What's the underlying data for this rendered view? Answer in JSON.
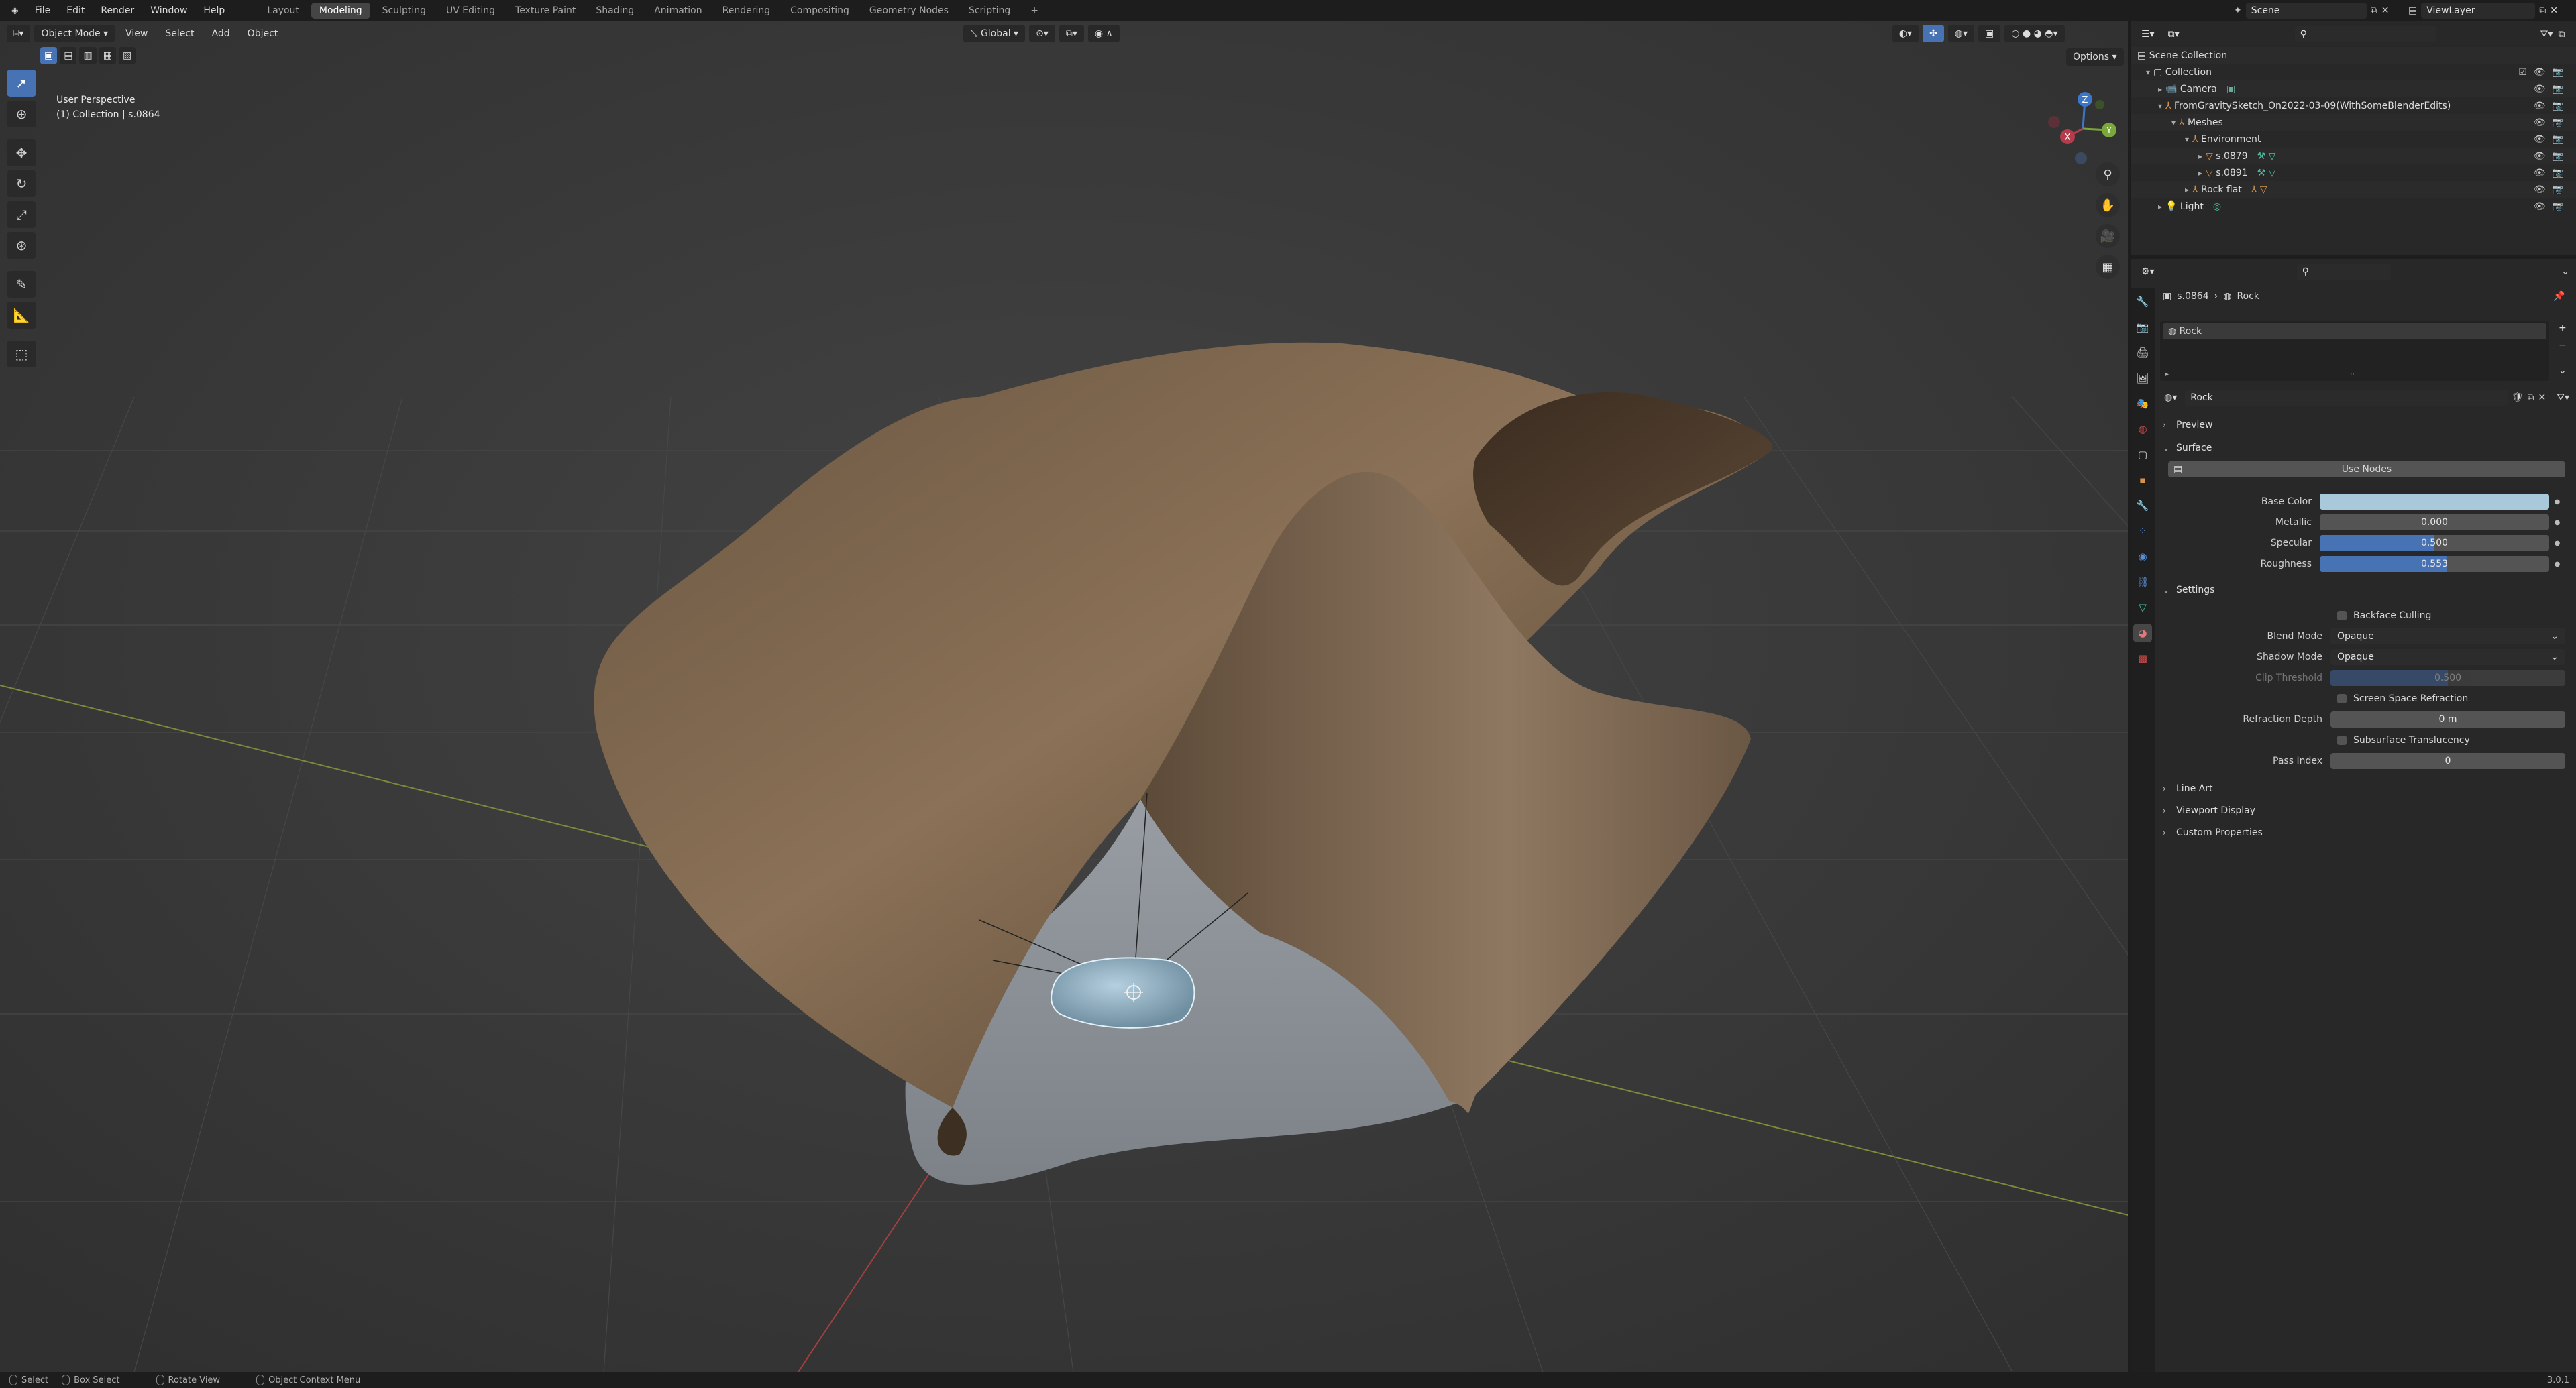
{
  "menu": {
    "file": "File",
    "edit": "Edit",
    "render": "Render",
    "window": "Window",
    "help": "Help"
  },
  "workspaces": [
    "Layout",
    "Modeling",
    "Sculpting",
    "UV Editing",
    "Texture Paint",
    "Shading",
    "Animation",
    "Rendering",
    "Compositing",
    "Geometry Nodes",
    "Scripting"
  ],
  "active_workspace": "Modeling",
  "scene": "Scene",
  "view_layer": "ViewLayer",
  "viewport": {
    "mode": "Object Mode",
    "menus": {
      "view": "View",
      "select": "Select",
      "add": "Add",
      "object": "Object"
    },
    "orientation": "Global",
    "options": "Options",
    "perspective": "User Perspective",
    "collection_info": "(1) Collection | s.0864",
    "gizmo": {
      "x": "X",
      "y": "Y",
      "z": "Z"
    }
  },
  "outliner": {
    "rows": [
      {
        "label": "Scene Collection",
        "depth": 0
      },
      {
        "label": "Collection",
        "depth": 1
      },
      {
        "label": "Camera",
        "depth": 2
      },
      {
        "label": "FromGravitySketch_On2022-03-09(WithSomeBlenderEdits)",
        "depth": 2
      },
      {
        "label": "Meshes",
        "depth": 3
      },
      {
        "label": "Environment",
        "depth": 4
      },
      {
        "label": "s.0879",
        "depth": 5
      },
      {
        "label": "s.0891",
        "depth": 5
      },
      {
        "label": "Rock flat",
        "depth": 4
      },
      {
        "label": "Light",
        "depth": 2
      }
    ]
  },
  "properties": {
    "breadcrumb_object": "s.0864",
    "breadcrumb_material": "Rock",
    "slot_name": "Rock",
    "material_name": "Rock",
    "panels": {
      "preview": "Preview",
      "surface": "Surface",
      "settings": "Settings",
      "line_art": "Line Art",
      "viewport_display": "Viewport Display",
      "custom_properties": "Custom Properties"
    },
    "use_nodes": "Use Nodes",
    "base_color_label": "Base Color",
    "base_color": "#a9c8da",
    "metallic": {
      "label": "Metallic",
      "value": "0.000",
      "fraction": 0.0
    },
    "specular": {
      "label": "Specular",
      "value": "0.500",
      "fraction": 0.5
    },
    "roughness": {
      "label": "Roughness",
      "value": "0.553",
      "fraction": 0.553
    },
    "backface_culling": "Backface Culling",
    "blend_mode": {
      "label": "Blend Mode",
      "value": "Opaque"
    },
    "shadow_mode": {
      "label": "Shadow Mode",
      "value": "Opaque"
    },
    "clip_threshold": {
      "label": "Clip Threshold",
      "value": "0.500"
    },
    "screen_space_refraction": "Screen Space Refraction",
    "refraction_depth": {
      "label": "Refraction Depth",
      "value": "0 m"
    },
    "subsurface_translucency": "Subsurface Translucency",
    "pass_index": {
      "label": "Pass Index",
      "value": "0"
    }
  },
  "status": {
    "select": "Select",
    "box_select": "Box Select",
    "rotate_view": "Rotate View",
    "context_menu": "Object Context Menu",
    "version": "3.0.1"
  },
  "colors": {
    "accent": "#4772b3",
    "viewport_bg": "#3b3b3b",
    "panel_bg": "#282828"
  }
}
